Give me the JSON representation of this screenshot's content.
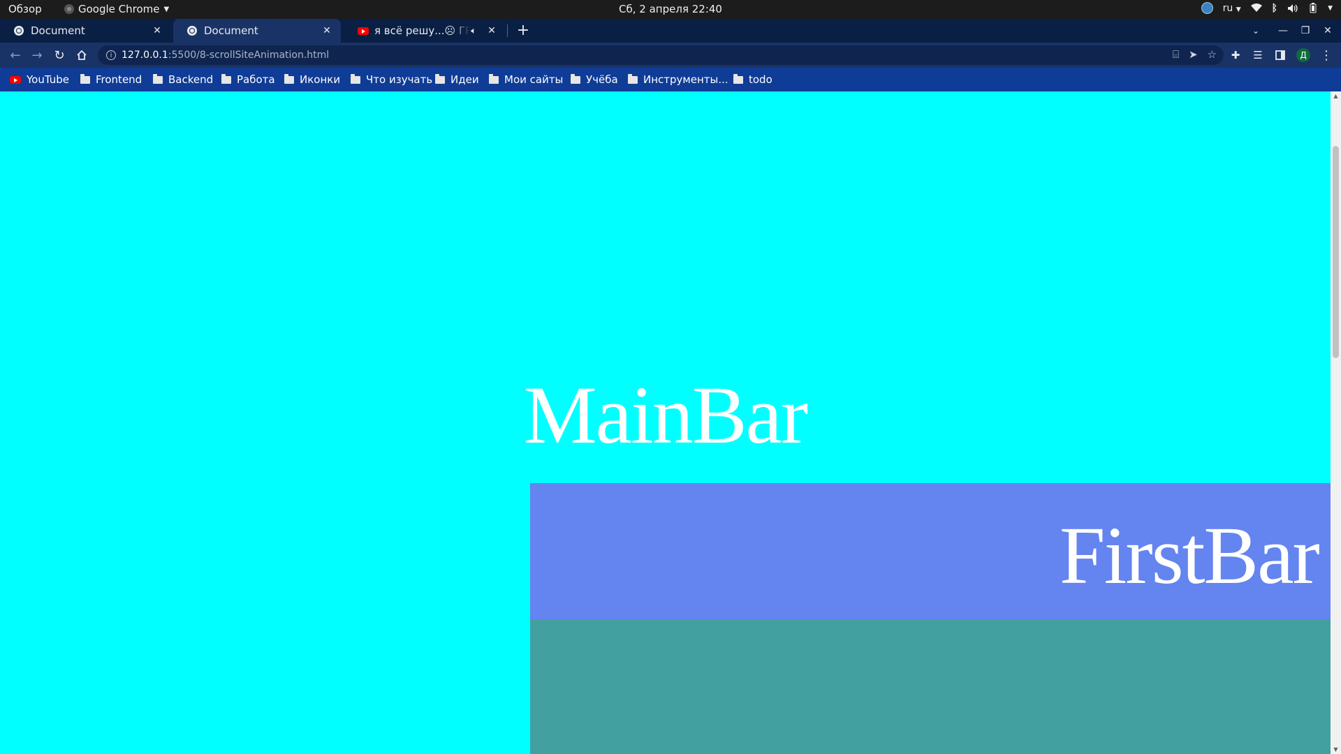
{
  "system_bar": {
    "activities": "Обзор",
    "app_name": "Google Chrome",
    "clock": "Сб, 2 апреля  22:40",
    "language": "ru"
  },
  "tabs": [
    {
      "title": "Document",
      "active": false,
      "icon": "globe-icon"
    },
    {
      "title": "Document",
      "active": true,
      "icon": "globe-icon"
    },
    {
      "title": "я всё решу...☹ ГРУСТ",
      "active": false,
      "icon": "youtube-icon",
      "audio": true
    }
  ],
  "toolbar": {
    "url_host": "127.0.0.1",
    "url_path": ":5500/8-scrollSiteAnimation.html",
    "profile_initial": "Д"
  },
  "bookmarks": [
    {
      "label": "YouTube",
      "icon": "youtube-icon"
    },
    {
      "label": "Frontend",
      "icon": "folder-icon"
    },
    {
      "label": "Backend",
      "icon": "folder-icon"
    },
    {
      "label": "Работа",
      "icon": "folder-icon"
    },
    {
      "label": "Иконки",
      "icon": "folder-icon"
    },
    {
      "label": "Что изучать",
      "icon": "folder-icon"
    },
    {
      "label": "Идеи",
      "icon": "folder-icon"
    },
    {
      "label": "Мои сайты",
      "icon": "folder-icon"
    },
    {
      "label": "Учёба",
      "icon": "folder-icon"
    },
    {
      "label": "Инструменты...",
      "icon": "folder-icon"
    },
    {
      "label": "todo",
      "icon": "folder-icon"
    }
  ],
  "page": {
    "main_bar": "MainBar",
    "first_bar": "FirstBar",
    "colors": {
      "background": "#00ffff",
      "first_bar": "#6484f0",
      "second_bar": "#43a0a0"
    }
  }
}
